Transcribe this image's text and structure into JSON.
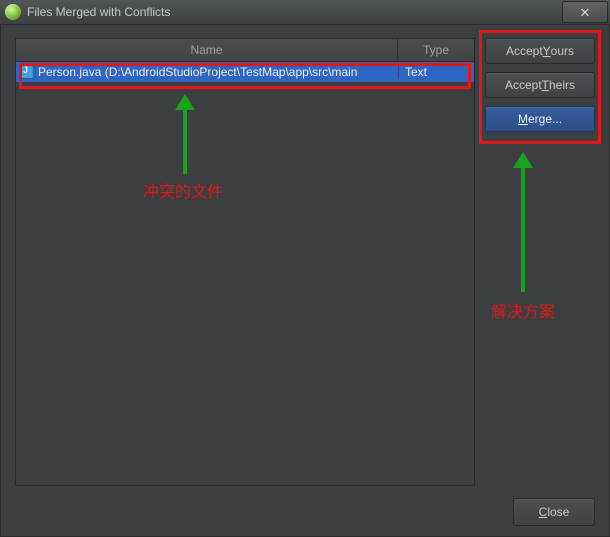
{
  "window": {
    "title": "Files Merged with Conflicts"
  },
  "table": {
    "headers": {
      "name": "Name",
      "type": "Type"
    },
    "rows": [
      {
        "name": "Person.java (D:\\AndroidStudioProject\\TestMap\\app\\src\\main",
        "type": "Text"
      }
    ]
  },
  "actions": {
    "accept_yours_pre": "Accept ",
    "accept_yours_u": "Y",
    "accept_yours_post": "ours",
    "accept_theirs_pre": "Accept ",
    "accept_theirs_u": "T",
    "accept_theirs_post": "heirs",
    "merge_u": "M",
    "merge_post": "erge..."
  },
  "footer": {
    "close_u": "C",
    "close_post": "lose"
  },
  "annotations": {
    "files_label": "冲突的文件",
    "solution_label": "解决方案"
  }
}
